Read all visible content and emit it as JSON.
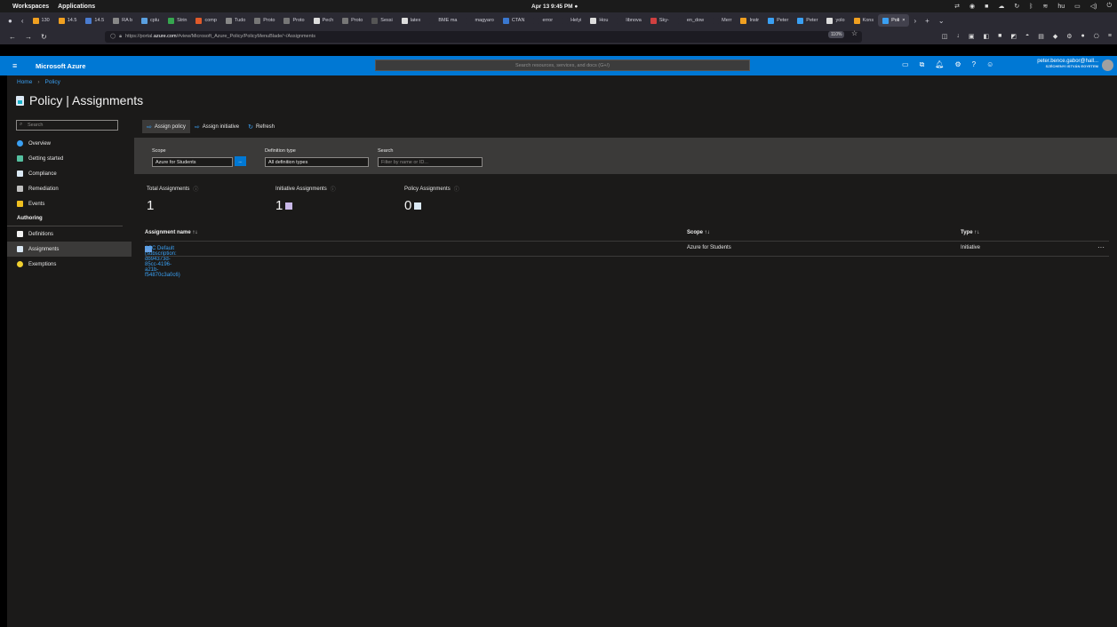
{
  "os": {
    "menu": [
      "Workspaces",
      "Applications"
    ],
    "clock": "Apr 13  9:45 PM  ●",
    "lang": "hu"
  },
  "browser": {
    "tabs": [
      {
        "label": "130",
        "color": "#f0a020"
      },
      {
        "label": "14.5",
        "color": "#f0a020"
      },
      {
        "label": "14.5",
        "color": "#4a7cd0"
      },
      {
        "label": "RA b",
        "color": "#888888"
      },
      {
        "label": "cplu",
        "color": "#5aa0e0"
      },
      {
        "label": "Strin",
        "color": "#36a64f"
      },
      {
        "label": "comp",
        "color": "#e05a2a"
      },
      {
        "label": "Tudo",
        "color": "#888888"
      },
      {
        "label": "Proto",
        "color": "#777777"
      },
      {
        "label": "Proto",
        "color": "#777777"
      },
      {
        "label": "Pech",
        "color": "#dddddd"
      },
      {
        "label": "Proto",
        "color": "#777777"
      },
      {
        "label": "Sessi",
        "color": "#555555"
      },
      {
        "label": "latex",
        "color": "#dddddd"
      },
      {
        "label": "BME ma",
        "color": "#2b2a33"
      },
      {
        "label": "magyaro",
        "color": "#2b2a33"
      },
      {
        "label": "CTAN",
        "color": "#3a78d0"
      },
      {
        "label": "error",
        "color": "#2b2a33"
      },
      {
        "label": "Helyi",
        "color": "#2b2a33"
      },
      {
        "label": "Hou",
        "color": "#dddddd"
      },
      {
        "label": "libnova",
        "color": "#2b2a33"
      },
      {
        "label": "Sky-",
        "color": "#d04040"
      },
      {
        "label": "en_dow",
        "color": "#2b2a33"
      },
      {
        "label": "Merr",
        "color": "#2b2a33"
      },
      {
        "label": "Instr",
        "color": "#f0a020"
      },
      {
        "label": "Peter",
        "color": "#3aa0f3"
      },
      {
        "label": "Peter",
        "color": "#3aa0f3"
      },
      {
        "label": "yolo",
        "color": "#dddddd"
      },
      {
        "label": "Kons",
        "color": "#f0a020"
      },
      {
        "label": "Poli",
        "color": "#3aa0f3",
        "active": true
      }
    ],
    "url_prefix": "https://portal.",
    "url_host": "azure.com",
    "url_rest": "/#view/Microsoft_Azure_Policy/PolicyMenuBlade/~/Assignments",
    "zoom": "110%"
  },
  "azure": {
    "brand": "Microsoft Azure",
    "search_placeholder": "Search resources, services, and docs (G+/)",
    "user_email": "peter.bence.gabor@hall...",
    "user_org": "SZÉCHENYI ISTVÁN EGYETEM"
  },
  "page": {
    "breadcrumb": [
      "Home",
      "Policy"
    ],
    "title": "Policy | Assignments"
  },
  "nav": {
    "search_placeholder": "Search",
    "items": [
      {
        "label": "Overview",
        "color": "#3aa0f3"
      },
      {
        "label": "Getting started",
        "color": "#55c0a0"
      },
      {
        "label": "Compliance",
        "color": "#dbe9f5"
      },
      {
        "label": "Remediation",
        "color": "#c0c0c0"
      },
      {
        "label": "Events",
        "color": "#f0c020"
      }
    ],
    "section": "Authoring",
    "authoring": [
      {
        "label": "Definitions",
        "color": "#f2f2f2"
      },
      {
        "label": "Assignments",
        "color": "#dbe9f5",
        "active": true
      },
      {
        "label": "Exemptions",
        "color": "#f0d030"
      }
    ]
  },
  "commands": {
    "assign_policy": "Assign policy",
    "assign_initiative": "Assign initiative",
    "refresh": "Refresh"
  },
  "filters": {
    "scope_label": "Scope",
    "scope_value": "Azure for Students",
    "scope_button": "...",
    "deftype_label": "Definition type",
    "deftype_value": "All definition types",
    "search_label": "Search",
    "search_placeholder": "Filter by name or ID..."
  },
  "summary": {
    "total_label": "Total Assignments",
    "total_value": "1",
    "initiative_label": "Initiative Assignments",
    "initiative_value": "1",
    "policy_label": "Policy Assignments",
    "policy_value": "0"
  },
  "table": {
    "headers": {
      "name": "Assignment name ↑↓",
      "scope": "Scope ↑↓",
      "type": "Type ↑↓"
    },
    "rows": [
      {
        "name": "ASC Default (subscription: db94373d-85cc-4196-a21b-f54870c3a0c6)",
        "scope": "Azure for Students",
        "type": "Initiative",
        "more": "···"
      }
    ]
  }
}
